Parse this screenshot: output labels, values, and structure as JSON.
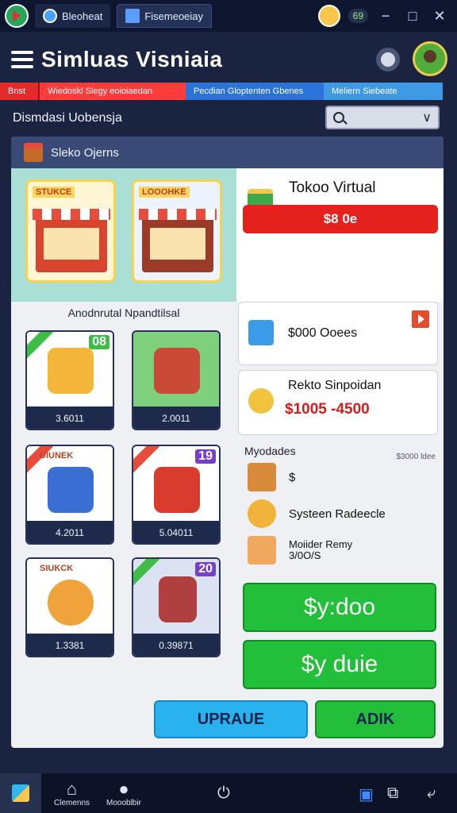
{
  "window": {
    "tab1": "Bleoheat",
    "tab2": "Fisemeoeiay",
    "coins": "69",
    "minimize": "−",
    "maximize": "□",
    "close": "✕"
  },
  "header": {
    "title": "Simluas Visniaia"
  },
  "strip": [
    "Bnst",
    "Wiedoskl  Slegy  eoioiaedan",
    "Pecdian Gloptenten Gbenes",
    "Meliern Siebeate"
  ],
  "subheader": {
    "label": "Dismdasi Uobensja",
    "search_chevron": "∨"
  },
  "panel": {
    "title": "Sleko Ojerns",
    "featured": [
      {
        "tag": "STUKCE"
      },
      {
        "tag": "LOOOHKE"
      }
    ],
    "section_title": "Anodnrutal Npandtilsal",
    "grid": [
      {
        "price": "3.6011",
        "badge": "08",
        "color": "#f3b63b"
      },
      {
        "price": "2.0011",
        "badge": "",
        "color": "#c94a36"
      },
      {
        "price": "4.2011",
        "badge": "",
        "tag": "UIUNEK",
        "color": "#3a6fd1"
      },
      {
        "price": "5.04011",
        "badge": "19",
        "color": "#d93c2f"
      },
      {
        "price": "1.3381",
        "badge": "",
        "tag": "SIUKCK",
        "color": "#f0a33b"
      },
      {
        "price": "0.39871",
        "badge": "20",
        "color": "#b03f3f"
      }
    ],
    "info": {
      "name": "Tokoo Virtual",
      "price": "$8 0e"
    },
    "card1": {
      "text": "$000 Ooees"
    },
    "card2": {
      "title": "Rekto Sinpoidan",
      "price": "$1005 -4500"
    },
    "list": {
      "head": "Myodades",
      "side": "$3000 ldee",
      "items": [
        {
          "label": "$",
          "color": "#d88b3a"
        },
        {
          "label": "Systeen Radeecle",
          "color": "#f0b43b"
        },
        {
          "label": "Moiider Remy",
          "sub": "3/0O/S",
          "color": "#f0a85e"
        }
      ]
    },
    "btn_green1": "$y:doo",
    "btn_green2": "$y duie",
    "btn_upgrade": "UPRAUE",
    "btn_add": "ADIK"
  },
  "taskbar": {
    "item1": "Clemenns",
    "item2": "Moooblbir"
  }
}
